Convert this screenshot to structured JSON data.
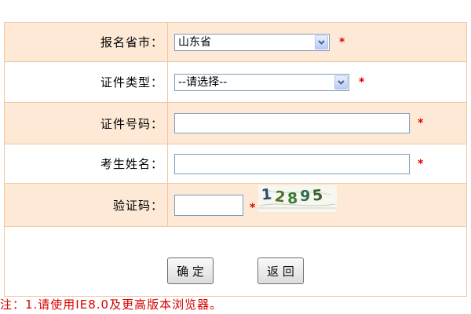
{
  "form": {
    "province": {
      "label": "报名省市：",
      "value": "山东省"
    },
    "id_type": {
      "label": "证件类型：",
      "value": "--请选择--"
    },
    "id_number": {
      "label": "证件号码："
    },
    "name": {
      "label": "考生姓名："
    },
    "captcha": {
      "label": "验证码：",
      "image_text": "12895"
    },
    "required_mark": "*"
  },
  "buttons": {
    "confirm": "确 定",
    "back": "返 回"
  },
  "note": "注：1.请使用IE8.0及更高版本浏览器。",
  "colors": {
    "row_highlight": "#FDE9D6",
    "border": "#F0C9A4",
    "required": "#E00000",
    "note": "#D40000"
  },
  "icons": {
    "select_dropdown": "chevron-down-icon"
  }
}
